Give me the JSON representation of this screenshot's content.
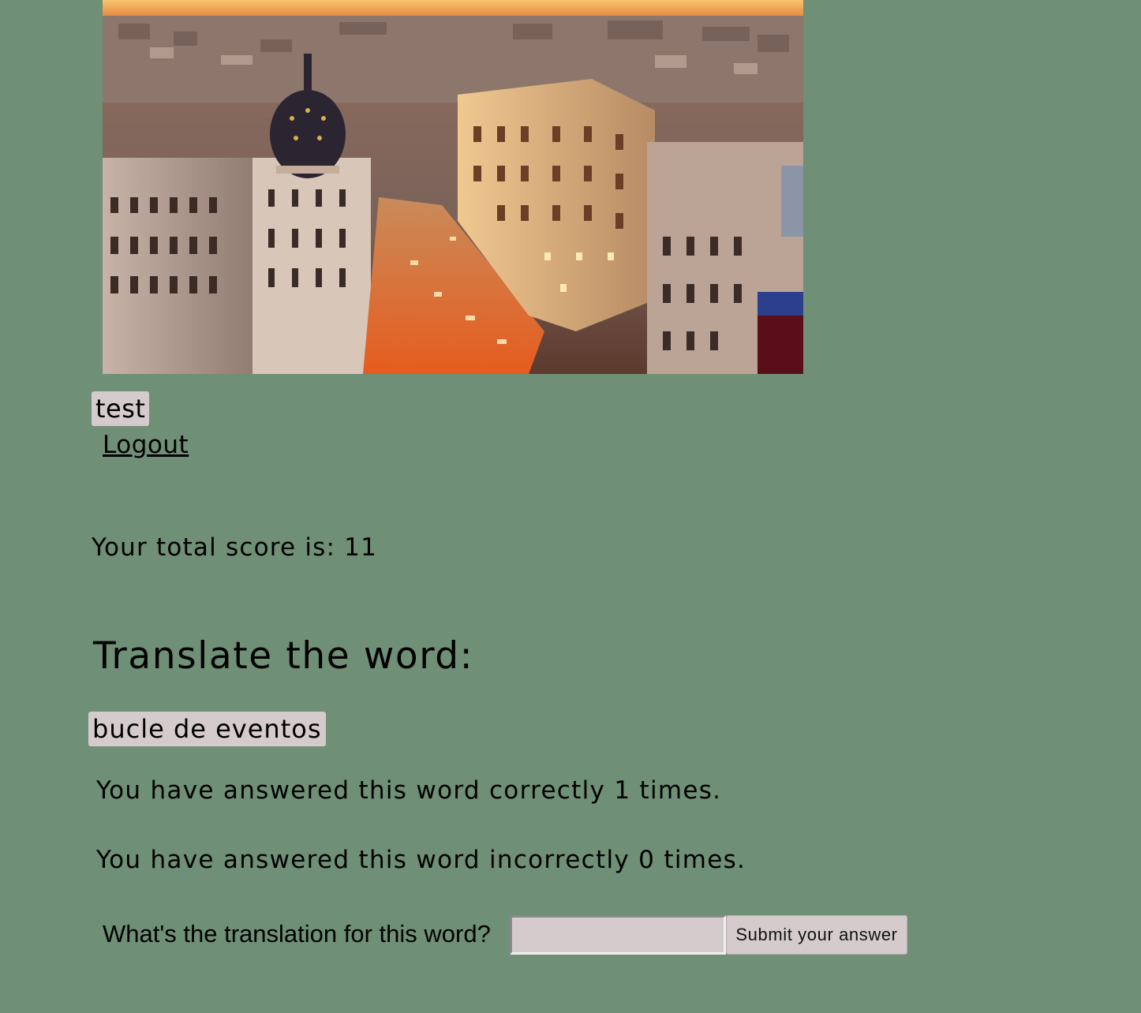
{
  "header": {
    "image_alt": "Madrid city view"
  },
  "user": {
    "name": "test",
    "logout_label": "Logout"
  },
  "score": {
    "text": "Your total score is: 11"
  },
  "quiz": {
    "heading": "Translate the word:",
    "word": "bucle de eventos",
    "correct_text": "You have answered this word correctly 1 times.",
    "incorrect_text": "You have answered this word incorrectly 0 times.",
    "prompt_label": "What's the translation for this word?",
    "answer_value": "",
    "submit_label": "Submit your answer"
  },
  "colors": {
    "page_background": "#6f8f76",
    "chip_background": "#d5cbcc"
  }
}
